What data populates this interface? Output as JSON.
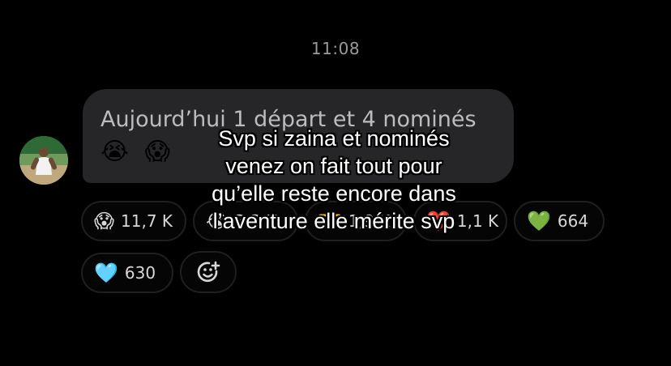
{
  "time": "11:08",
  "message": {
    "text": "Aujourd’hui 1 départ et 4 nominés",
    "emojis": [
      "😭",
      "😱"
    ]
  },
  "reactions": [
    {
      "emoji": "😱",
      "count": "11,7 K"
    },
    {
      "emoji": "😭",
      "count": "3,3 K"
    },
    {
      "emoji": "💳",
      "count": "1,9 K"
    },
    {
      "emoji": "❤️",
      "count": "1,1 K"
    },
    {
      "emoji": "💚",
      "count": "664"
    },
    {
      "emoji": "🩵",
      "count": "630"
    }
  ],
  "add_reaction_icon": "add-reaction-icon",
  "caption_lines": [
    "Svp si zaina et nominés",
    "venez on fait tout pour",
    "qu’elle reste encore dans",
    "l’aventure elle mérite svp"
  ]
}
